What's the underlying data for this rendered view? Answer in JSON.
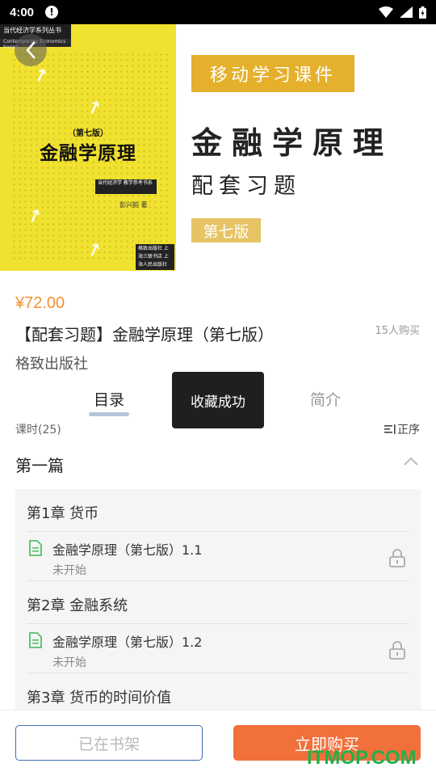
{
  "status_bar": {
    "time": "4:00",
    "alert": "!"
  },
  "cover": {
    "series": "当代经济学系列丛书",
    "series_sub": "Contemporary Economics Series",
    "edition": "（第七版）",
    "title": "金融学原理",
    "box_label": "当代经济学 教学参考书系",
    "author": "彭兴韵 著",
    "publisher": "格致出版社 上海三联书店 上海人民出版社"
  },
  "hero": {
    "badge": "移动学习课件",
    "title": "金融学原理",
    "subtitle": "配套习题",
    "edition": "第七版"
  },
  "product": {
    "price": "¥72.00",
    "title": "【配套习题】金融学原理（第七版）",
    "buyers": "15人购买",
    "publisher": "格致出版社"
  },
  "tabs": {
    "toc": "目录",
    "intro": "简介"
  },
  "toast": "收藏成功",
  "toc": {
    "lessons_count": "课时(25)",
    "sort_label": "正序",
    "part_title": "第一篇",
    "chapters": [
      {
        "title": "第1章 货币",
        "lesson_name": "金融学原理（第七版）1.1",
        "lesson_status": "未开始"
      },
      {
        "title": "第2章 金融系统",
        "lesson_name": "金融学原理（第七版）1.2",
        "lesson_status": "未开始"
      },
      {
        "title": "第3章 货币的时间价值"
      }
    ]
  },
  "bottom": {
    "shelf_label": "已在书架",
    "buy_label": "立即购买"
  },
  "watermark": "ITMOP.COM",
  "colors": {
    "accent": "#f2703c",
    "price": "#f2922e",
    "badge": "#e5b02c",
    "watermark": "#22b04a"
  }
}
